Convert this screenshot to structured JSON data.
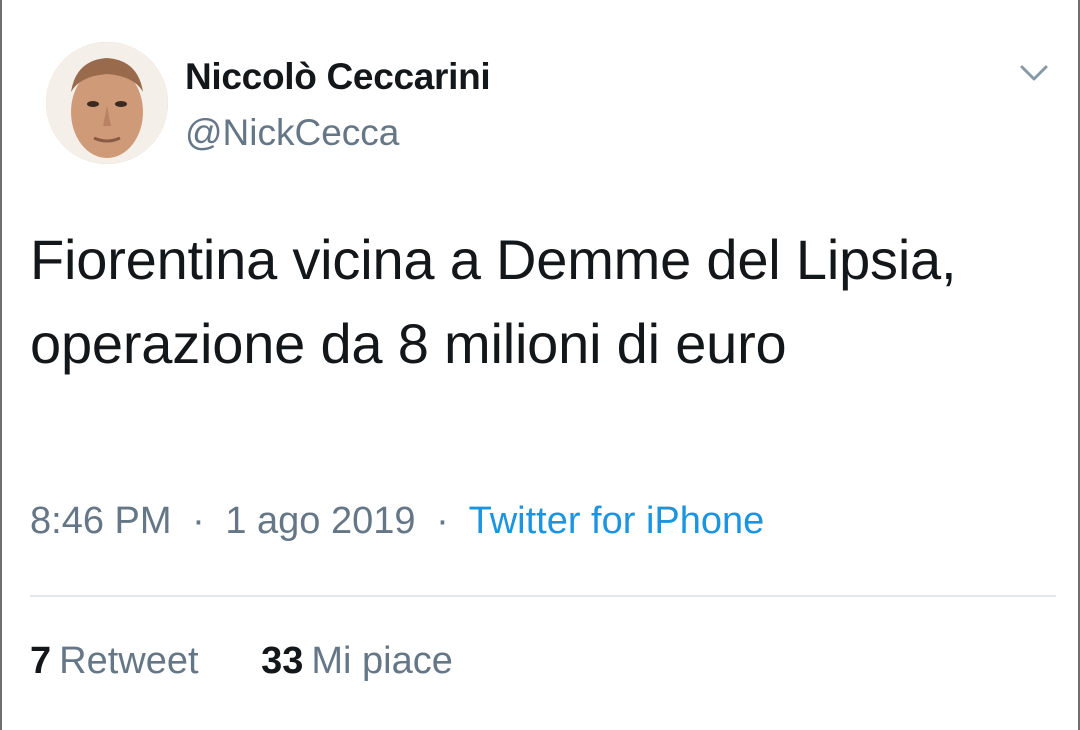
{
  "author": {
    "name": "Niccolò Ceccarini",
    "handle": "@NickCecca"
  },
  "tweet": {
    "text": "Fiorentina vicina a Demme del Lipsia, operazione da 8 milioni di euro",
    "time": "8:46 PM",
    "date": "1 ago 2019",
    "separator": "·",
    "source": "Twitter for iPhone"
  },
  "stats": {
    "retweets_count": "7",
    "retweets_label": "Retweet",
    "likes_count": "33",
    "likes_label": "Mi piace"
  },
  "icons": {
    "menu": "chevron-down-icon"
  },
  "colors": {
    "text_primary": "#14171a",
    "text_secondary": "#657786",
    "link": "#1b95e0",
    "divider": "#e1e8ed"
  }
}
